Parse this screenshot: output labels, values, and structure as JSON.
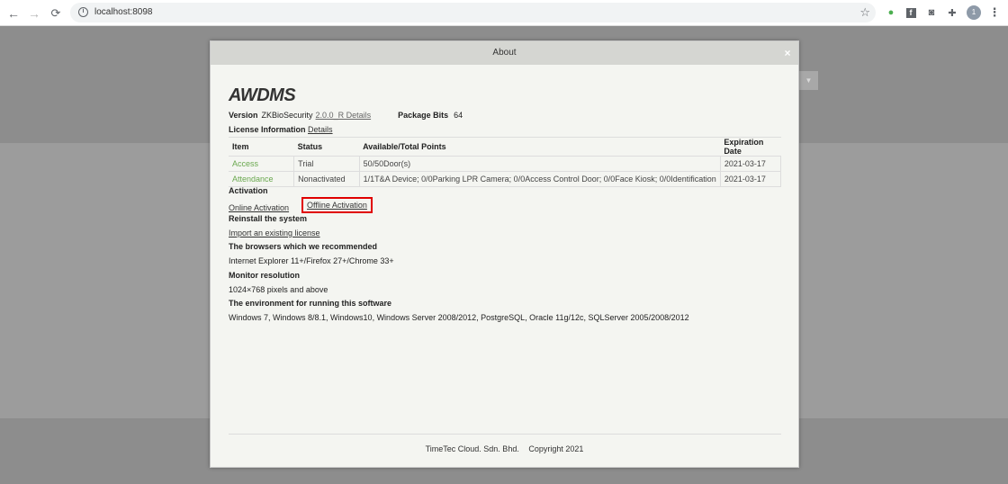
{
  "browser": {
    "url": "localhost:8098",
    "back_icon": "arrow-left-icon",
    "forward_icon": "arrow-right-icon",
    "reload_icon": "reload-icon",
    "profile_initial": "1"
  },
  "dialog": {
    "title": "About",
    "close_symbol": "×",
    "logo_text": "AWDMS",
    "version_label": "Version",
    "version_value": "ZKBioSecurity",
    "version_link": "2.0.0_R Details",
    "package_bits_label": "Package Bits",
    "package_bits_value": "64",
    "license_label": "License Information",
    "license_link": "Details",
    "table": {
      "headers": [
        "Item",
        "Status",
        "Available/Total Points",
        "Expiration Date"
      ],
      "rows": [
        [
          "Access",
          "Trial",
          "50/50Door(s)",
          "2021-03-17"
        ],
        [
          "Attendance",
          "Nonactivated",
          "1/1T&A Device; 0/0Parking LPR Camera; 0/0Access Control Door; 0/0Face Kiosk; 0/0Identification",
          "2021-03-17"
        ]
      ]
    },
    "activation_label": "Activation",
    "online_activation": "Online Activation",
    "offline_activation": "Offline Activation",
    "reinstall_label": "Reinstall the system",
    "import_license": "Import an existing license",
    "browsers_label": "The browsers which we recommended",
    "browsers_value": "Internet Explorer 11+/Firefox 27+/Chrome 33+",
    "monitor_label": "Monitor resolution",
    "monitor_value": "1024×768 pixels and above",
    "env_label": "The environment for running this software",
    "env_value": "Windows 7, Windows 8/8.1, Windows10, Windows Server 2008/2012, PostgreSQL, Oracle 11g/12c, SQLServer 2005/2008/2012",
    "footer_company": "TimeTec Cloud. Sdn. Bhd.",
    "footer_copyright": "Copyright 2021"
  },
  "colors": {
    "highlight_box": "#e00000",
    "item_link_green": "#6aa84f",
    "overlay": "#9c9c9c"
  }
}
